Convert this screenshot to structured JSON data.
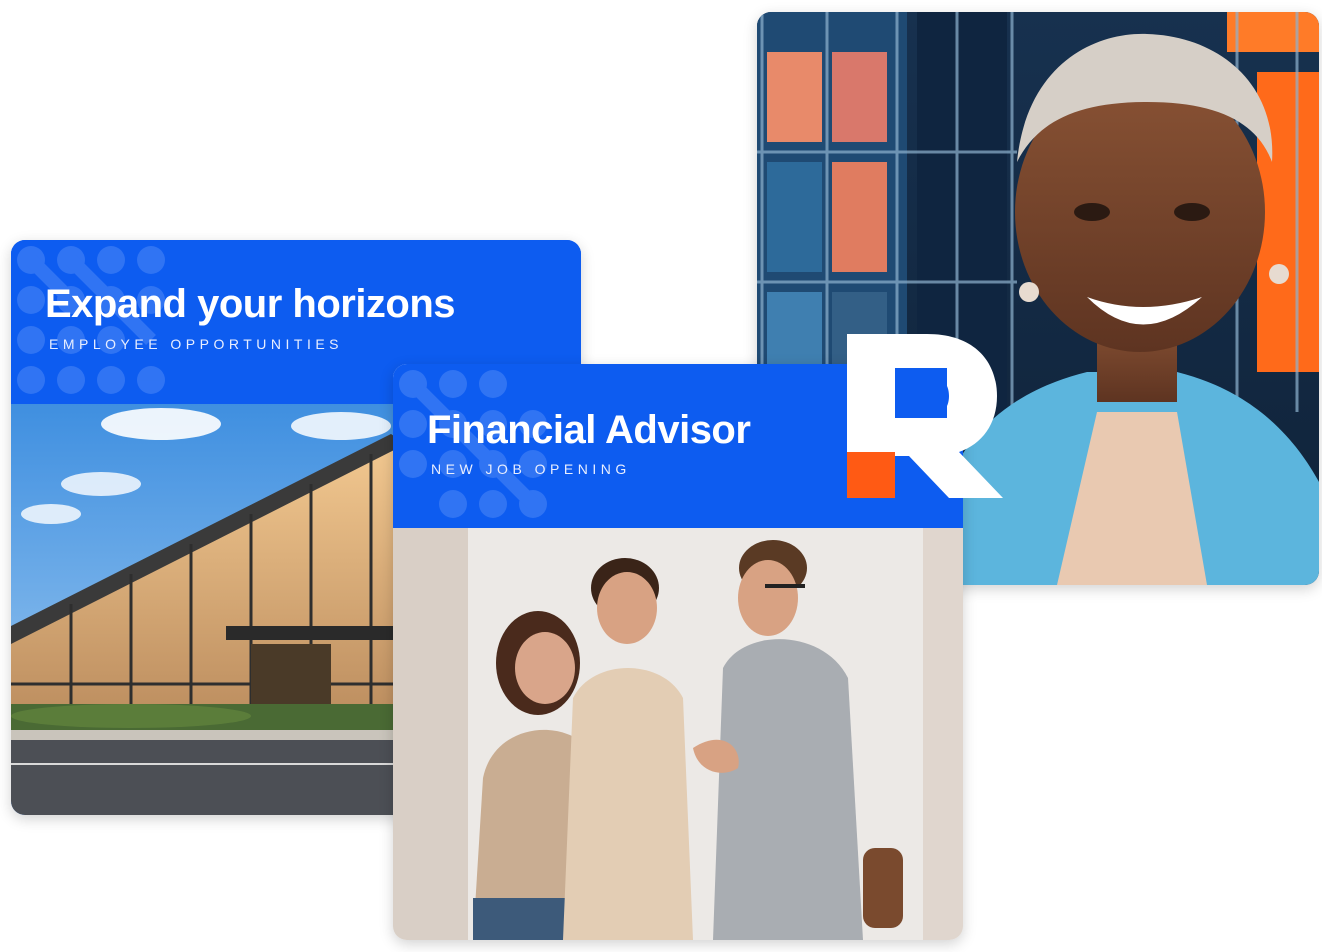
{
  "cards": {
    "expand": {
      "title": "Expand your horizons",
      "subtitle": "EMPLOYEE OPPORTUNITIES"
    },
    "financial": {
      "title": "Financial Advisor",
      "subtitle": "NEW JOB OPENING"
    }
  },
  "colors": {
    "brand_blue": "#0d5cf0",
    "brand_orange": "#ff5a14"
  },
  "icons": [
    "dot-pattern-decoration",
    "brand-r-logo"
  ]
}
